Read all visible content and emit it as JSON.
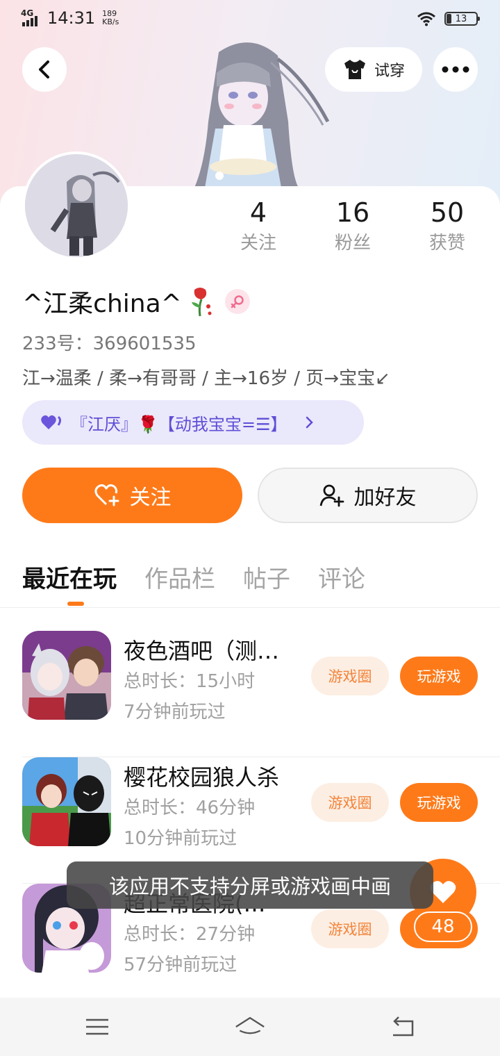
{
  "status_bar": {
    "network": "4G",
    "time": "14:31",
    "speed_value": "189",
    "speed_unit": "KB/s",
    "battery": "13"
  },
  "header": {
    "try_on_label": "试穿"
  },
  "profile": {
    "stats": [
      {
        "value": "4",
        "label": "关注"
      },
      {
        "value": "16",
        "label": "粉丝"
      },
      {
        "value": "50",
        "label": "获赞"
      }
    ],
    "username": "^江柔china^",
    "user_id": "233号：369601535",
    "bio": "江→温柔 / 柔→有哥哥 / 主→16岁 / 页→宝宝↙",
    "guild_text": "『江厌』🌹【动我宝宝=☰】"
  },
  "actions": {
    "follow_label": "关注",
    "add_friend_label": "加好友"
  },
  "tabs": [
    "最近在玩",
    "作品栏",
    "帖子",
    "评论"
  ],
  "games": [
    {
      "title": "夜色酒吧（测…",
      "duration": "总时长：15小时",
      "last_played": "7分钟前玩过",
      "circle_label": "游戏圈",
      "play_label": "玩游戏"
    },
    {
      "title": "樱花校园狼人杀",
      "duration": "总时长：46分钟",
      "last_played": "10分钟前玩过",
      "circle_label": "游戏圈",
      "play_label": "玩游戏"
    },
    {
      "title": "超正常医院(…",
      "duration": "总时长：27分钟",
      "last_played": "57分钟前玩过",
      "circle_label": "游戏圈",
      "play_label": "玩游戏"
    }
  ],
  "toast": "该应用不支持分屏或游戏画中画",
  "like_count": "48",
  "colors": {
    "accent": "#fe7a19",
    "accent_light": "#fdeee3",
    "guild_bg": "#eae8fb",
    "guild_text": "#5e4ed6"
  }
}
